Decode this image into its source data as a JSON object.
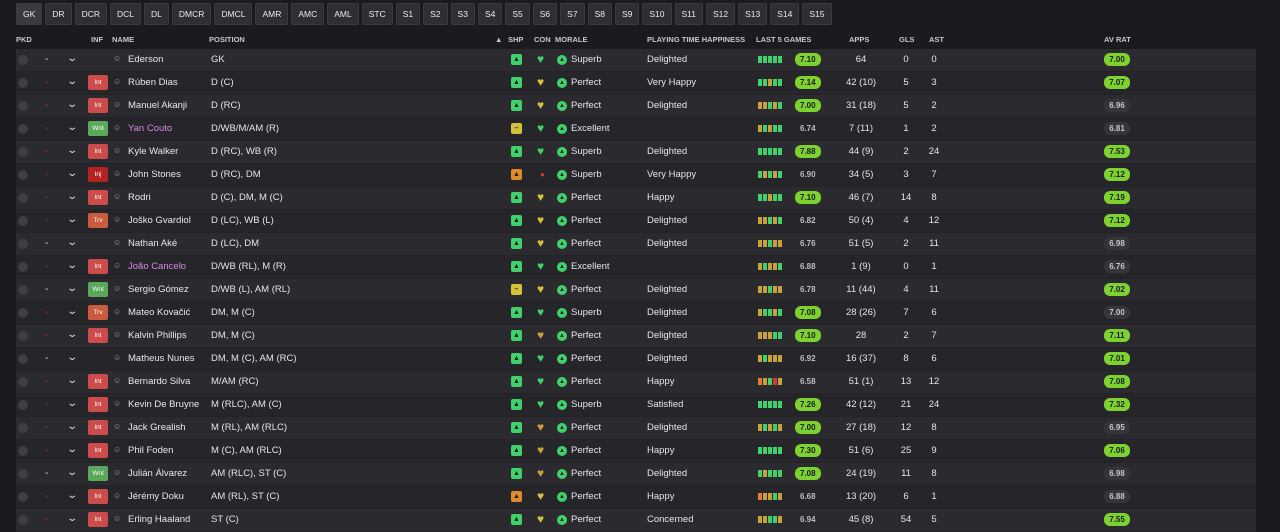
{
  "tabs": [
    "GK",
    "DR",
    "DCR",
    "DCL",
    "DL",
    "DMCR",
    "DMCL",
    "AMR",
    "AMC",
    "AML",
    "STC",
    "S1",
    "S2",
    "S3",
    "S4",
    "S5",
    "S6",
    "S7",
    "S8",
    "S9",
    "S10",
    "S11",
    "S12",
    "S13",
    "S14",
    "S15"
  ],
  "columns": {
    "pkd": "PKD",
    "inf": "INF",
    "name": "NAME",
    "position": "POSITION",
    "sort": "▲",
    "shp": "SHP",
    "con": "CON",
    "morale": "MORALE",
    "happiness": "PLAYING TIME HAPPINESS",
    "last5": "LAST 5 GAMES",
    "apps": "APPS",
    "gls": "GLS",
    "ast": "AST",
    "avrat": "AV RAT"
  },
  "colors": {
    "green": "#41d16b",
    "yellow": "#d5c23a",
    "orange": "#e08a2c",
    "red": "#d43a3a",
    "rating_good": "#7dd22f",
    "bar_green": "#41d16b",
    "bar_gold": "#c9a13a",
    "bar_orange": "#e07b39",
    "bar_red": "#d43a3a"
  },
  "players": [
    {
      "dash": "-",
      "dash_red": false,
      "inf": "",
      "name": "Ederson",
      "purple": false,
      "position": "GK",
      "shp": "green",
      "con": "green",
      "morale": "Superb",
      "happiness": "Delighted",
      "bars": [
        "green",
        "green",
        "green",
        "green",
        "green"
      ],
      "last5": "7.10",
      "last5_good": true,
      "apps": "64",
      "gls": "0",
      "ast": "0",
      "avrat": "7.00",
      "avrat_good": true
    },
    {
      "dash": "-",
      "dash_red": true,
      "inf": "Int",
      "name": "Rúben Dias",
      "purple": false,
      "position": "D (C)",
      "shp": "green",
      "con": "yellow",
      "morale": "Perfect",
      "happiness": "Very Happy",
      "bars": [
        "green",
        "green",
        "gold",
        "green",
        "green"
      ],
      "last5": "7.14",
      "last5_good": true,
      "apps": "42 (10)",
      "gls": "5",
      "ast": "3",
      "avrat": "7.07",
      "avrat_good": true
    },
    {
      "dash": "-",
      "dash_red": true,
      "inf": "Int",
      "name": "Manuel Akanji",
      "purple": false,
      "position": "D (RC)",
      "shp": "green",
      "con": "yellow",
      "morale": "Perfect",
      "happiness": "Delighted",
      "bars": [
        "gold",
        "gold",
        "green",
        "gold",
        "green"
      ],
      "last5": "7.00",
      "last5_good": true,
      "apps": "31 (18)",
      "gls": "5",
      "ast": "2",
      "avrat": "6.96",
      "avrat_good": false
    },
    {
      "dash": "-",
      "dash_red": true,
      "inf": "Wnt",
      "name": "Yan Couto",
      "purple": true,
      "position": "D/WB/M/AM (R)",
      "shp": "yellow",
      "con": "green",
      "morale": "Excellent",
      "happiness": "",
      "bars": [
        "gold",
        "green",
        "gold",
        "green",
        "green"
      ],
      "last5": "6.74",
      "last5_good": false,
      "apps": "7 (11)",
      "gls": "1",
      "ast": "2",
      "avrat": "6.81",
      "avrat_good": false
    },
    {
      "dash": "-",
      "dash_red": true,
      "inf": "Int",
      "name": "Kyle Walker",
      "purple": false,
      "position": "D (RC), WB (R)",
      "shp": "green",
      "con": "green",
      "morale": "Superb",
      "happiness": "Delighted",
      "bars": [
        "green",
        "green",
        "green",
        "green",
        "green"
      ],
      "last5": "7.88",
      "last5_good": true,
      "apps": "44 (9)",
      "gls": "2",
      "ast": "24",
      "avrat": "7.53",
      "avrat_good": true
    },
    {
      "dash": "-",
      "dash_red": true,
      "inf": "Inj",
      "name": "John Stones",
      "purple": false,
      "position": "D (RC), DM",
      "shp": "orange",
      "con": "red",
      "morale": "Superb",
      "happiness": "Very Happy",
      "bars": [
        "green",
        "gold",
        "green",
        "gold",
        "green"
      ],
      "last5": "6.90",
      "last5_good": false,
      "apps": "34 (5)",
      "gls": "3",
      "ast": "7",
      "avrat": "7.12",
      "avrat_good": true
    },
    {
      "dash": "-",
      "dash_red": true,
      "inf": "Int",
      "name": "Rodri",
      "purple": false,
      "position": "D (C), DM, M (C)",
      "shp": "green",
      "con": "yellow",
      "morale": "Perfect",
      "happiness": "Happy",
      "bars": [
        "green",
        "green",
        "gold",
        "green",
        "green"
      ],
      "last5": "7.10",
      "last5_good": true,
      "apps": "46 (7)",
      "gls": "14",
      "ast": "8",
      "avrat": "7.19",
      "avrat_good": true
    },
    {
      "dash": "-",
      "dash_red": true,
      "inf": "Trv",
      "name": "Joško Gvardiol",
      "purple": false,
      "position": "D (LC), WB (L)",
      "shp": "green",
      "con": "yellow",
      "morale": "Perfect",
      "happiness": "Delighted",
      "bars": [
        "gold",
        "gold",
        "green",
        "gold",
        "green"
      ],
      "last5": "6.82",
      "last5_good": false,
      "apps": "50 (4)",
      "gls": "4",
      "ast": "12",
      "avrat": "7.12",
      "avrat_good": true
    },
    {
      "dash": "-",
      "dash_red": false,
      "inf": "",
      "name": "Nathan Aké",
      "purple": false,
      "position": "D (LC), DM",
      "shp": "green",
      "con": "yellow",
      "morale": "Perfect",
      "happiness": "Delighted",
      "bars": [
        "gold",
        "gold",
        "green",
        "gold",
        "gold"
      ],
      "last5": "6.76",
      "last5_good": false,
      "apps": "51 (5)",
      "gls": "2",
      "ast": "11",
      "avrat": "6.98",
      "avrat_good": false
    },
    {
      "dash": "-",
      "dash_red": true,
      "inf": "Int",
      "name": "João Cancelo",
      "purple": true,
      "position": "D/WB (RL), M (R)",
      "shp": "green",
      "con": "green",
      "morale": "Excellent",
      "happiness": "",
      "bars": [
        "gold",
        "green",
        "gold",
        "gold",
        "green"
      ],
      "last5": "6.88",
      "last5_good": false,
      "apps": "1 (9)",
      "gls": "0",
      "ast": "1",
      "avrat": "6.76",
      "avrat_good": false
    },
    {
      "dash": "-",
      "dash_red": false,
      "inf": "Wnt",
      "name": "Sergio Gómez",
      "purple": false,
      "position": "D/WB (L), AM (RL)",
      "shp": "yellow",
      "con": "yellow",
      "morale": "Perfect",
      "happiness": "Delighted",
      "bars": [
        "gold",
        "gold",
        "green",
        "gold",
        "gold"
      ],
      "last5": "6.78",
      "last5_good": false,
      "apps": "11 (44)",
      "gls": "4",
      "ast": "11",
      "avrat": "7.02",
      "avrat_good": true
    },
    {
      "dash": "-",
      "dash_red": true,
      "inf": "Trv",
      "name": "Mateo Kovačić",
      "purple": false,
      "position": "DM, M (C)",
      "shp": "green",
      "con": "green",
      "morale": "Superb",
      "happiness": "Delighted",
      "bars": [
        "gold",
        "green",
        "green",
        "gold",
        "green"
      ],
      "last5": "7.08",
      "last5_good": true,
      "apps": "28 (26)",
      "gls": "7",
      "ast": "6",
      "avrat": "7.00",
      "avrat_good": false
    },
    {
      "dash": "-",
      "dash_red": true,
      "inf": "Int",
      "name": "Kalvin Phillips",
      "purple": false,
      "position": "DM, M (C)",
      "shp": "green",
      "con": "gold",
      "morale": "Perfect",
      "happiness": "Delighted",
      "bars": [
        "gold",
        "gold",
        "gold",
        "green",
        "green"
      ],
      "last5": "7.10",
      "last5_good": true,
      "apps": "28",
      "gls": "2",
      "ast": "7",
      "avrat": "7.11",
      "avrat_good": true
    },
    {
      "dash": "-",
      "dash_red": false,
      "inf": "",
      "name": "Matheus Nunes",
      "purple": false,
      "position": "DM, M (C), AM (RC)",
      "shp": "green",
      "con": "green",
      "morale": "Perfect",
      "happiness": "Delighted",
      "bars": [
        "gold",
        "green",
        "gold",
        "gold",
        "gold"
      ],
      "last5": "6.92",
      "last5_good": false,
      "apps": "16 (37)",
      "gls": "8",
      "ast": "6",
      "avrat": "7.01",
      "avrat_good": true
    },
    {
      "dash": "-",
      "dash_red": true,
      "inf": "Int",
      "name": "Bernardo Silva",
      "purple": false,
      "position": "M/AM (RC)",
      "shp": "green",
      "con": "green",
      "morale": "Perfect",
      "happiness": "Happy",
      "bars": [
        "orange",
        "gold",
        "green",
        "red",
        "gold"
      ],
      "last5": "6.58",
      "last5_good": false,
      "apps": "51 (1)",
      "gls": "13",
      "ast": "12",
      "avrat": "7.08",
      "avrat_good": true
    },
    {
      "dash": "-",
      "dash_red": true,
      "inf": "Int",
      "name": "Kevin De Bruyne",
      "purple": false,
      "position": "M (RLC), AM (C)",
      "shp": "green",
      "con": "green",
      "morale": "Superb",
      "happiness": "Satisfied",
      "bars": [
        "green",
        "green",
        "green",
        "green",
        "green"
      ],
      "last5": "7.26",
      "last5_good": true,
      "apps": "42 (12)",
      "gls": "21",
      "ast": "24",
      "avrat": "7.32",
      "avrat_good": true
    },
    {
      "dash": "-",
      "dash_red": true,
      "inf": "Int",
      "name": "Jack Grealish",
      "purple": false,
      "position": "M (RL), AM (RLC)",
      "shp": "green",
      "con": "gold",
      "morale": "Perfect",
      "happiness": "Delighted",
      "bars": [
        "gold",
        "green",
        "gold",
        "green",
        "gold"
      ],
      "last5": "7.00",
      "last5_good": true,
      "apps": "27 (18)",
      "gls": "12",
      "ast": "8",
      "avrat": "6.95",
      "avrat_good": false
    },
    {
      "dash": "-",
      "dash_red": true,
      "inf": "Int",
      "name": "Phil Foden",
      "purple": false,
      "position": "M (C), AM (RLC)",
      "shp": "green",
      "con": "gold",
      "morale": "Perfect",
      "happiness": "Happy",
      "bars": [
        "green",
        "green",
        "green",
        "green",
        "green"
      ],
      "last5": "7.30",
      "last5_good": true,
      "apps": "51 (6)",
      "gls": "25",
      "ast": "9",
      "avrat": "7.06",
      "avrat_good": true
    },
    {
      "dash": "-",
      "dash_red": false,
      "inf": "Wnt",
      "name": "Julián Álvarez",
      "purple": false,
      "position": "AM (RLC), ST (C)",
      "shp": "green",
      "con": "gold",
      "morale": "Perfect",
      "happiness": "Delighted",
      "bars": [
        "green",
        "gold",
        "green",
        "green",
        "green"
      ],
      "last5": "7.08",
      "last5_good": true,
      "apps": "24 (19)",
      "gls": "11",
      "ast": "8",
      "avrat": "6.98",
      "avrat_good": false
    },
    {
      "dash": "-",
      "dash_red": true,
      "inf": "Int",
      "name": "Jérémy Doku",
      "purple": false,
      "position": "AM (RL), ST (C)",
      "shp": "orange",
      "con": "yellow",
      "morale": "Perfect",
      "happiness": "Happy",
      "bars": [
        "orange",
        "gold",
        "gold",
        "green",
        "gold"
      ],
      "last5": "6.68",
      "last5_good": false,
      "apps": "13 (20)",
      "gls": "6",
      "ast": "1",
      "avrat": "6.88",
      "avrat_good": false
    },
    {
      "dash": "-",
      "dash_red": true,
      "inf": "Int",
      "name": "Erling Haaland",
      "purple": false,
      "position": "ST (C)",
      "shp": "green",
      "con": "yellow",
      "morale": "Perfect",
      "happiness": "Concerned",
      "bars": [
        "gold",
        "gold",
        "green",
        "green",
        "gold"
      ],
      "last5": "6.94",
      "last5_good": false,
      "apps": "45 (8)",
      "gls": "54",
      "ast": "5",
      "avrat": "7.55",
      "avrat_good": true
    }
  ]
}
